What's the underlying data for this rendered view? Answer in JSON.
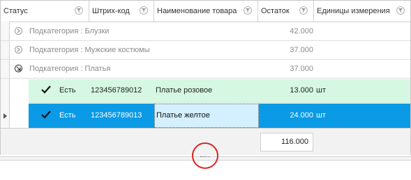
{
  "columns": [
    {
      "label": "Статус"
    },
    {
      "label": "Штрих-код"
    },
    {
      "label": "Наименование товара"
    },
    {
      "label": "Остаток"
    },
    {
      "label": "Единицы измерения"
    }
  ],
  "groups": [
    {
      "label": "Подкатегория : Блузки",
      "sum": "42.000",
      "expanded": false
    },
    {
      "label": "Подкатегория : Мужские костюмы",
      "sum": "37.000",
      "expanded": false
    },
    {
      "label": "Подкатегория : Платья",
      "sum": "37.000",
      "expanded": true
    }
  ],
  "rows": [
    {
      "status": "Есть",
      "barcode": "123456789012",
      "name": "Платье розовое",
      "qty": "13.000",
      "unit": "шт",
      "selected": false
    },
    {
      "status": "Есть",
      "barcode": "123456789013",
      "name": "Платье желтое",
      "qty": "24.000",
      "unit": "шт",
      "selected": true
    }
  ],
  "footer": {
    "total": "116.000"
  },
  "colors": {
    "selected_row": "#0a9ae6",
    "alt_row": "#d6f8e3",
    "focus_cell": "#d4f0ff",
    "annotation": "#e0221f"
  }
}
